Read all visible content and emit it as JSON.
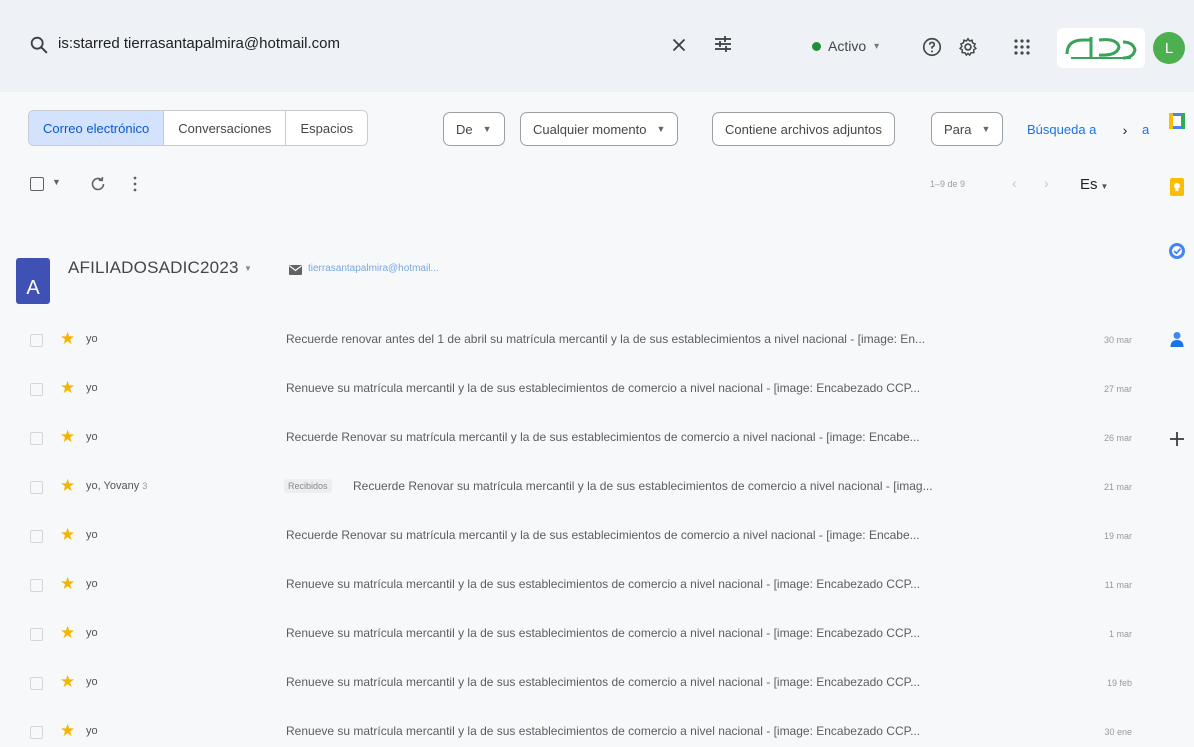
{
  "search": {
    "query": "is:starred tierrasantapalmira@hotmail.com"
  },
  "header": {
    "status_label": "Activo",
    "avatar_initial": "L"
  },
  "filters": {
    "segments": [
      "Correo electrónico",
      "Conversaciones",
      "Espacios"
    ],
    "chip_from": "De",
    "chip_time": "Cualquier momento",
    "chip_attachments": "Contiene archivos adjuntos",
    "chip_to": "Para",
    "advanced_link": "Búsqueda a",
    "advanced_tail": "a"
  },
  "toolbar": {
    "page_info": "1–9 de 9",
    "language": "Es"
  },
  "contact": {
    "initial": "A",
    "name": "AFILIADOSADIC2023",
    "email": "tierrasantapalmira@hotmail..."
  },
  "mails": [
    {
      "sender": "yo",
      "count": "",
      "label": "",
      "subject": "Recuerde renovar antes del 1 de abril su matrícula mercantil y la de sus establecimientos a nivel nacional - [image: En...",
      "date": "30 mar"
    },
    {
      "sender": "yo",
      "count": "",
      "label": "",
      "subject": "Renueve su matrícula mercantil y la de sus establecimientos de comercio a nivel nacional - [image: Encabezado CCP...",
      "date": "27 mar"
    },
    {
      "sender": "yo",
      "count": "",
      "label": "",
      "subject": "Recuerde Renovar su matrícula mercantil y la de sus establecimientos de comercio a nivel nacional - [image: Encabe...",
      "date": "26 mar"
    },
    {
      "sender": "yo, Yovany",
      "count": "3",
      "label": "Recibidos",
      "subject": "Recuerde Renovar su matrícula mercantil y la de sus establecimientos de comercio a nivel nacional - [imag...",
      "date": "21 mar"
    },
    {
      "sender": "yo",
      "count": "",
      "label": "",
      "subject": "Recuerde Renovar su matrícula mercantil y la de sus establecimientos de comercio a nivel nacional - [image: Encabe...",
      "date": "19 mar"
    },
    {
      "sender": "yo",
      "count": "",
      "label": "",
      "subject": "Renueve su matrícula mercantil y la de sus establecimientos de comercio a nivel nacional - [image: Encabezado CCP...",
      "date": "11 mar"
    },
    {
      "sender": "yo",
      "count": "",
      "label": "",
      "subject": "Renueve su matrícula mercantil y la de sus establecimientos de comercio a nivel nacional - [image: Encabezado CCP...",
      "date": "1 mar"
    },
    {
      "sender": "yo",
      "count": "",
      "label": "",
      "subject": "Renueve su matrícula mercantil y la de sus establecimientos de comercio a nivel nacional - [image: Encabezado CCP...",
      "date": "19 feb"
    },
    {
      "sender": "yo",
      "count": "",
      "label": "",
      "subject": "Renueve su matrícula mercantil y la de sus establecimientos de comercio a nivel nacional - [image: Encabezado CCP...",
      "date": "30 ene"
    }
  ],
  "side_panel": {
    "icons": [
      "calendar-icon",
      "keep-icon",
      "tasks-icon",
      "contacts-icon",
      "add-icon"
    ]
  },
  "colors": {
    "accent": "#0b57d0",
    "star": "#f4b400",
    "status_green": "#1e8e3e",
    "contact_avatar": "#3f51b5",
    "user_avatar": "#4caf50"
  }
}
